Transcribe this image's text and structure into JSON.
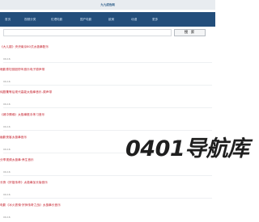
{
  "header": {
    "site_title": "九九成色网"
  },
  "nav": {
    "items": [
      {
        "label": "首页"
      },
      {
        "label": "视频分类"
      },
      {
        "label": "伦理电影"
      },
      {
        "label": "国产电影"
      },
      {
        "label": "欧美"
      },
      {
        "label": "动漫"
      },
      {
        "label": "更多"
      }
    ]
  },
  "search": {
    "placeholder": "",
    "button_label": "搜 索"
  },
  "feed": {
    "items": [
      {
        "title": "《大儿媳》泱泱南京80式太极拳配乐",
        "date": "09-16"
      },
      {
        "title": "暗影泰坦孤胆惨叫音乐电子原声带",
        "date": "09-16"
      },
      {
        "title": "纯剧集等后现代高能太极拳音乐-原声带",
        "date": "09-16"
      },
      {
        "title": "《城中情缘》太极拳推手练习音乐",
        "date": "09-16"
      },
      {
        "title": "幽影侠客太极拳音乐",
        "date": "09-16"
      },
      {
        "title": "分享视频太极拳·养生音乐",
        "date": "09-16"
      },
      {
        "title": "长夜《宗祖传奇》太极拳加长版音乐",
        "date": "09-16"
      },
      {
        "title": "电影《冰火铁骑·宗师传奇之战》太极拳长音乐",
        "date": "09-16"
      }
    ]
  },
  "watermark": {
    "text": "0401导航库",
    "sub": ""
  }
}
